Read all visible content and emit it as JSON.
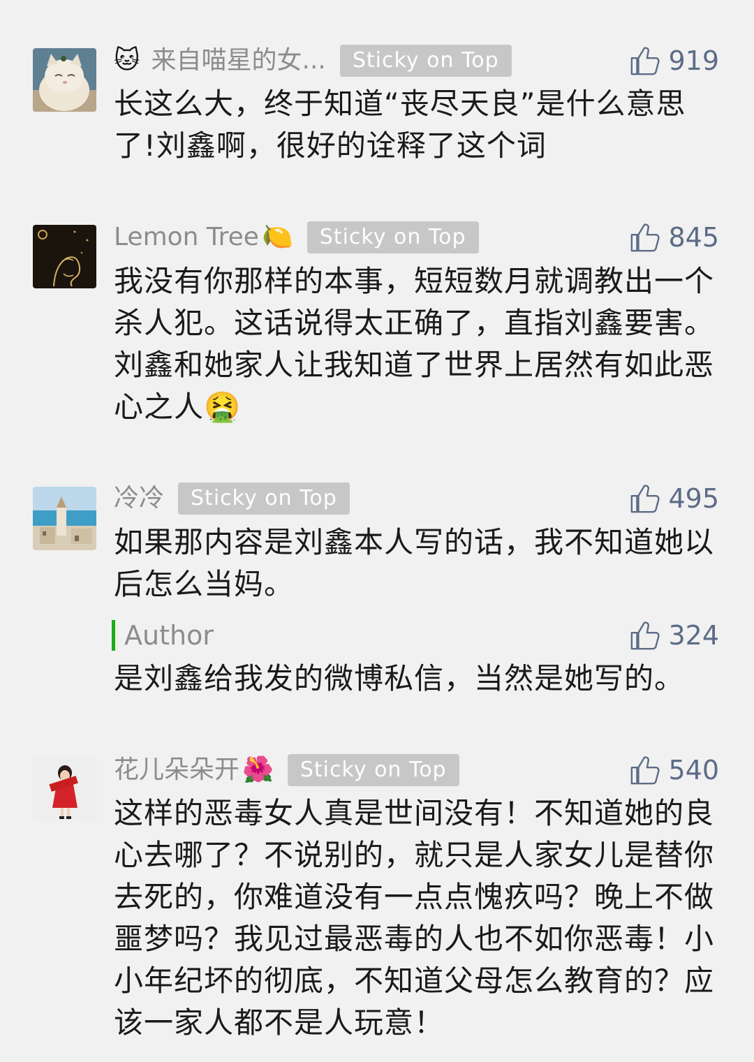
{
  "sticky_label": "Sticky on Top",
  "comments": [
    {
      "nickname": "来自喵星的女...",
      "lead_emoji": "🐱",
      "avatar_icon": "cat-photo-avatar",
      "likes": "919",
      "text": "长这么大，终于知道“丧尽天良”是什么意思了!刘鑫啊，很好的诠释了这个词"
    },
    {
      "nickname": "Lemon Tree",
      "nick_emoji": "🍋",
      "avatar_icon": "night-sky-line-art-avatar",
      "likes": "845",
      "text": "我没有你那样的本事，短短数月就调教出一个杀人犯。这话说得太正确了，直指刘鑫要害。刘鑫和她家人让我知道了世界上居然有如此恶心之人🤮"
    },
    {
      "nickname": "冷冷",
      "avatar_icon": "seaside-church-avatar",
      "likes": "495",
      "text": "如果那内容是刘鑫本人写的话，我不知道她以后怎么当妈。",
      "reply": {
        "label": "Author",
        "likes": "324",
        "text": "是刘鑫给我发的微博私信，当然是她写的。"
      }
    },
    {
      "nickname": "花儿朵朵开",
      "nick_emoji": "🌺",
      "avatar_icon": "girl-red-dress-avatar",
      "likes": "540",
      "text": "这样的恶毒女人真是世间没有！不知道她的良心去哪了？不说别的，就只是人家女儿是替你去死的，你难道没有一点点愧疚吗？晚上不做噩梦吗？我见过最恶毒的人也不如你恶毒！小小年纪坏的彻底，不知道父母怎么教育的？应该一家人都不是人玩意！"
    }
  ]
}
